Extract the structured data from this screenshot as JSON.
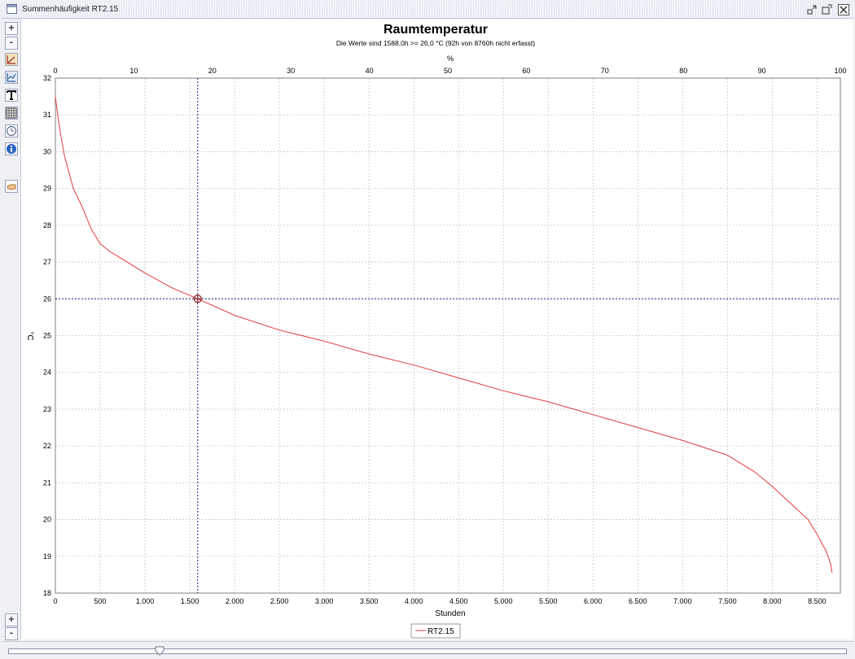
{
  "window": {
    "title": "Summenhäufigkeit RT2.15"
  },
  "controls": {
    "zoom_in_label": "+",
    "zoom_out_label": "-",
    "window_buttons": [
      "minimize-icon",
      "maximize-icon",
      "close-icon"
    ],
    "toolbar_icons": [
      "chart-icon",
      "chart-settings-icon",
      "text-icon",
      "table-icon",
      "clock-icon",
      "info-icon",
      "hand-icon"
    ]
  },
  "chart_data": {
    "type": "line",
    "title": "Raumtemperatur",
    "subtitle": "Die Werte sind  1588,0h >= 26,0 °C (92h von 8760h nicht erfasst)",
    "xlabel": "Stunden",
    "x2label": "%",
    "ylabel": "°C",
    "xlim": [
      0,
      8760
    ],
    "ylim": [
      18,
      32
    ],
    "x_ticks": [
      "0",
      "500",
      "1.000",
      "1.500",
      "2.000",
      "2.500",
      "3.000",
      "3.500",
      "4.000",
      "4.500",
      "5.000",
      "5.500",
      "6.000",
      "6.500",
      "7.000",
      "7.500",
      "8.000",
      "8.500"
    ],
    "x2_ticks": [
      "0",
      "10",
      "20",
      "30",
      "40",
      "50",
      "60",
      "70",
      "80",
      "90",
      "100"
    ],
    "y_ticks": [
      "18",
      "19",
      "20",
      "21",
      "22",
      "23",
      "24",
      "25",
      "26",
      "27",
      "28",
      "29",
      "30",
      "31",
      "32"
    ],
    "grid": true,
    "legend_position": "bottom",
    "line_color": "#e03c3c",
    "series": [
      {
        "name": "RT2.15",
        "x": [
          0,
          25,
          50,
          100,
          200,
          300,
          400,
          500,
          600,
          800,
          1000,
          1300,
          1588,
          2000,
          2500,
          3000,
          3500,
          4000,
          4500,
          5000,
          5500,
          6000,
          6500,
          7000,
          7500,
          7800,
          8000,
          8200,
          8400,
          8500,
          8600,
          8650,
          8668
        ],
        "y": [
          31.5,
          31.0,
          30.6,
          29.9,
          29.0,
          28.5,
          27.9,
          27.5,
          27.3,
          27.0,
          26.7,
          26.3,
          26.0,
          25.55,
          25.15,
          24.85,
          24.5,
          24.2,
          23.85,
          23.5,
          23.2,
          22.85,
          22.5,
          22.15,
          21.75,
          21.3,
          20.9,
          20.45,
          20.0,
          19.6,
          19.15,
          18.8,
          18.55
        ]
      }
    ],
    "crosshair": {
      "x": 1588,
      "y": 26.0,
      "color": "#1a1a80"
    }
  }
}
